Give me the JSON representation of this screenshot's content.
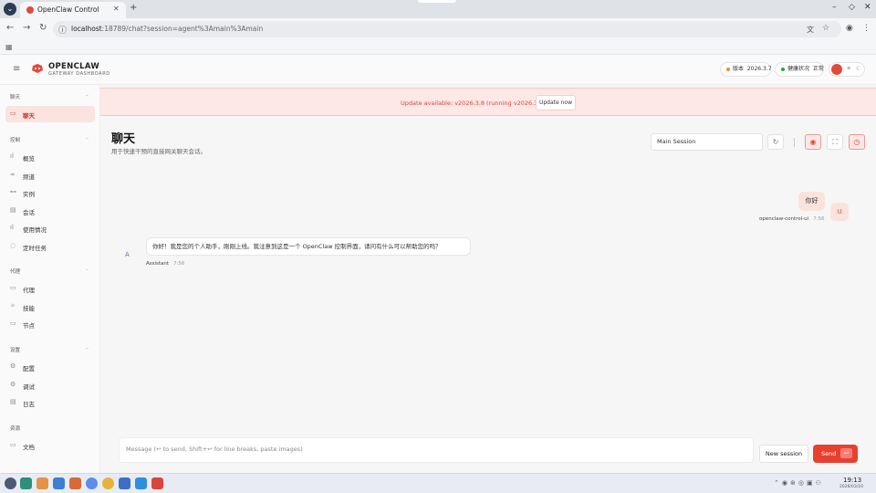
{
  "browser": {
    "tab_title": "OpenClaw Control",
    "url_host": "localhost",
    "url_path": ":18789/chat?session=agent%3Amain%3Amain"
  },
  "header": {
    "brand": "OPENCLAW",
    "brand_sub": "GATEWAY DASHBOARD",
    "version_label": "版本",
    "version_value": "2026.3.7",
    "health_label": "健康状况",
    "health_value": "正常"
  },
  "sidebar": {
    "sections": [
      {
        "label": "聊天",
        "items": [
          {
            "label": "聊天",
            "icon": "chat-icon"
          }
        ]
      },
      {
        "label": "控制",
        "items": [
          {
            "label": "概览",
            "icon": "overview-icon"
          },
          {
            "label": "频道",
            "icon": "link-icon"
          },
          {
            "label": "实例",
            "icon": "instance-icon"
          },
          {
            "label": "会话",
            "icon": "doc-icon"
          },
          {
            "label": "使用情况",
            "icon": "usage-icon"
          },
          {
            "label": "定时任务",
            "icon": "cron-icon"
          }
        ]
      },
      {
        "label": "代理",
        "items": [
          {
            "label": "代理",
            "icon": "folder-icon"
          },
          {
            "label": "技能",
            "icon": "sparkle-icon"
          },
          {
            "label": "节点",
            "icon": "monitor-icon"
          }
        ]
      },
      {
        "label": "设置",
        "items": [
          {
            "label": "配置",
            "icon": "gear-icon"
          },
          {
            "label": "调试",
            "icon": "bug-icon"
          },
          {
            "label": "日志",
            "icon": "log-icon"
          }
        ]
      },
      {
        "label": "资源",
        "items": [
          {
            "label": "文档",
            "icon": "book-icon"
          }
        ]
      }
    ]
  },
  "banner": {
    "text": "Update available: v2026.3.8 (running v2026.3.7).",
    "button": "Update now"
  },
  "chat": {
    "title": "聊天",
    "subtitle": "用于快速干预的直接网关聊天会话。",
    "session_select": "Main Session",
    "messages": [
      {
        "role": "user",
        "avatar": "U",
        "text": "你好",
        "sender": "openclaw-control-ui",
        "time": "7:56"
      },
      {
        "role": "assistant",
        "avatar": "A",
        "text": "你好！我是您的个人助手，刚刚上线。我注意到这是一个 OpenClaw 控制界面，请问有什么可以帮助您的吗？",
        "sender": "Assistant",
        "time": "7:56"
      }
    ],
    "composer_placeholder": "Message (↩ to send, Shift+↩ for line breaks, paste images)",
    "new_session": "New session",
    "send": "Send",
    "send_kbd": "↩"
  },
  "taskbar": {
    "time": "19:13",
    "date": "2026/03/10"
  },
  "colors": {
    "accent": "#e14a3b",
    "active_bg": "#fbe3e0",
    "banner_bg": "#fde8e5",
    "health_ok": "#2aa34a",
    "version_dot": "#f08c2e"
  }
}
